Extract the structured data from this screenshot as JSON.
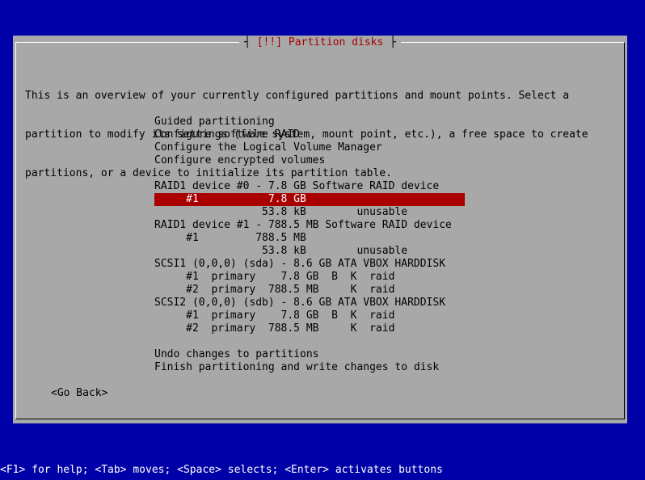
{
  "dialog": {
    "title_marker": "[!!]",
    "title_text": "Partition disks",
    "intro_lines": [
      "This is an overview of your currently configured partitions and mount points. Select a",
      "partition to modify its settings (file system, mount point, etc.), a free space to create",
      "partitions, or a device to initialize its partition table."
    ],
    "actions": [
      "Guided partitioning",
      "Configure software RAID",
      "Configure the Logical Volume Manager",
      "Configure encrypted volumes"
    ],
    "devices": [
      "RAID1 device #0 - 7.8 GB Software RAID device",
      "     #1           7.8 GB",
      "                 53.8 kB        unusable",
      "RAID1 device #1 - 788.5 MB Software RAID device",
      "     #1         788.5 MB",
      "                 53.8 kB        unusable",
      "SCSI1 (0,0,0) (sda) - 8.6 GB ATA VBOX HARDDISK",
      "     #1  primary    7.8 GB  B  K  raid",
      "     #2  primary  788.5 MB     K  raid",
      "SCSI2 (0,0,0) (sdb) - 8.6 GB ATA VBOX HARDDISK",
      "     #1  primary    7.8 GB  B  K  raid",
      "     #2  primary  788.5 MB     K  raid"
    ],
    "finish_actions": [
      "Undo changes to partitions",
      "Finish partitioning and write changes to disk"
    ],
    "go_back_label": "<Go Back>"
  },
  "status_bar": {
    "help_text": "<F1> for help; <Tab> moves; <Space> selects; <Enter> activates buttons"
  },
  "colors": {
    "background": "#0000a8",
    "dialog": "#a8a8a8",
    "selection": "#a80000",
    "title_text": "#a80000",
    "selected_text": "#ffffff"
  }
}
